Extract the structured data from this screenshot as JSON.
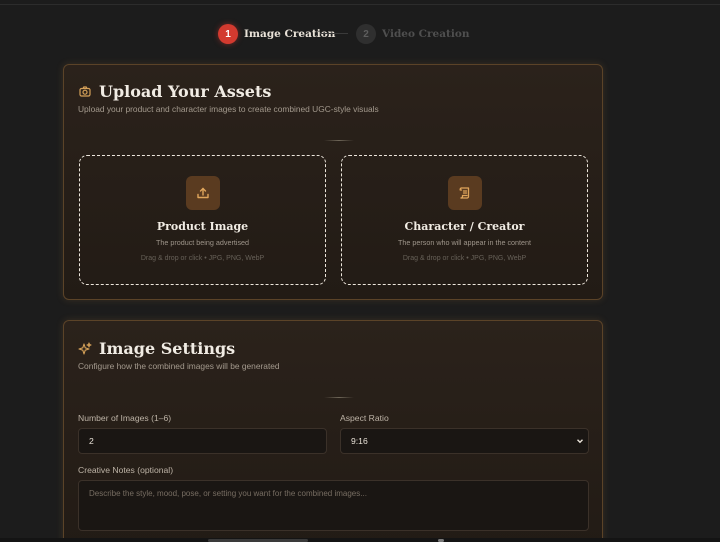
{
  "stepper": {
    "steps": [
      {
        "number": "1",
        "label": "Image Creation",
        "active": true
      },
      {
        "number": "2",
        "label": "Video Creation",
        "active": false
      }
    ]
  },
  "upload": {
    "title": "Upload Your Assets",
    "subtitle": "Upload your product and character images to create combined UGC-style visuals",
    "icon": "camera-icon",
    "zones": [
      {
        "icon": "upload-icon",
        "title": "Product Image",
        "description": "The product being advertised",
        "hint": "Drag & drop or click • JPG, PNG, WebP"
      },
      {
        "icon": "scroll-icon",
        "title": "Character / Creator",
        "description": "The person who will appear in the content",
        "hint": "Drag & drop or click • JPG, PNG, WebP"
      }
    ]
  },
  "settings": {
    "title": "Image Settings",
    "subtitle": "Configure how the combined images will be generated",
    "icon": "sparkles-icon",
    "num_images_label": "Number of Images (1–6)",
    "num_images_value": "2",
    "aspect_label": "Aspect Ratio",
    "aspect_value": "9:16",
    "notes_label": "Creative Notes (optional)",
    "notes_placeholder": "Describe the style, mood, pose, or setting you want for the combined images..."
  },
  "colors": {
    "accent": "#d33a2f",
    "card_border": "#5b4328",
    "icon_gold": "#d4a058"
  }
}
